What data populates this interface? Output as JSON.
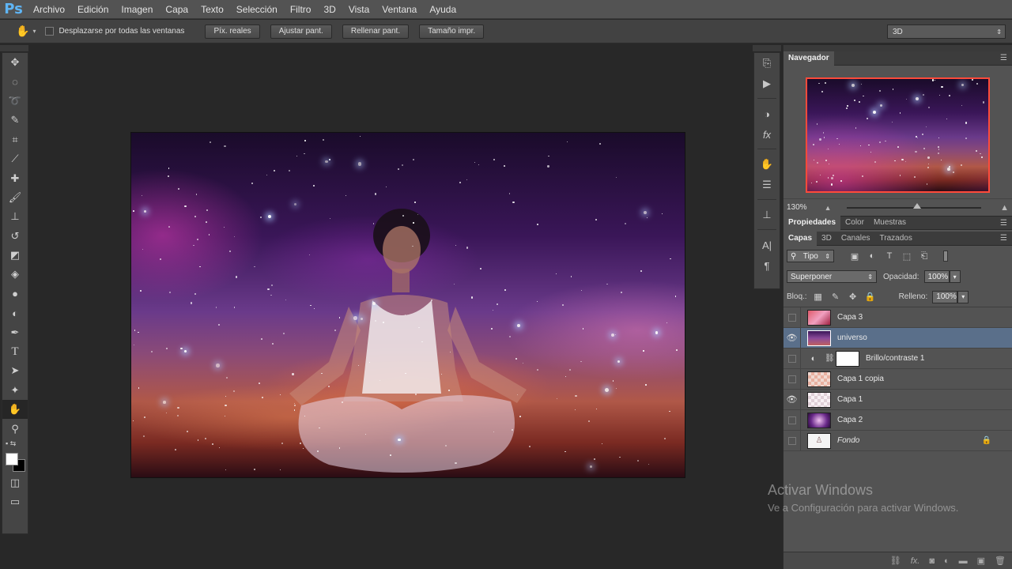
{
  "menubar": {
    "logo": "Ps",
    "items": [
      "Archivo",
      "Edición",
      "Imagen",
      "Capa",
      "Texto",
      "Selección",
      "Filtro",
      "3D",
      "Vista",
      "Ventana",
      "Ayuda"
    ]
  },
  "options": {
    "scroll_all_label": "Desplazarse por todas las ventanas",
    "buttons": [
      "Píx. reales",
      "Ajustar pant.",
      "Rellenar pant.",
      "Tamaño impr."
    ],
    "workspace": "3D"
  },
  "navigator": {
    "tab": "Navegador",
    "zoom": "130%"
  },
  "properties_tabs": [
    "Propiedades",
    "Color",
    "Muestras"
  ],
  "layers_tabs": [
    "Capas",
    "3D",
    "Canales",
    "Trazados"
  ],
  "layers_panel": {
    "filter_kind": "Tipo",
    "blend_mode": "Superponer",
    "opacity_label": "Opacidad:",
    "opacity_value": "100%",
    "lock_label": "Bloq.:",
    "fill_label": "Relleno:",
    "fill_value": "100%"
  },
  "layers": [
    {
      "name": "Capa 3",
      "visible": false
    },
    {
      "name": "universo",
      "visible": true,
      "selected": true
    },
    {
      "name": "Brillo/contraste 1",
      "visible": false,
      "adjustment": true
    },
    {
      "name": "Capa 1 copia",
      "visible": false
    },
    {
      "name": "Capa 1",
      "visible": true
    },
    {
      "name": "Capa 2",
      "visible": false
    },
    {
      "name": "Fondo",
      "visible": false,
      "locked": true
    }
  ],
  "watermark": {
    "title": "Activar Windows",
    "subtitle": "Ve a Configuración para activar Windows."
  },
  "icons": {
    "hand": "hand-icon",
    "eye": "eye-icon",
    "lock": "lock-icon",
    "link": "link-icon"
  }
}
